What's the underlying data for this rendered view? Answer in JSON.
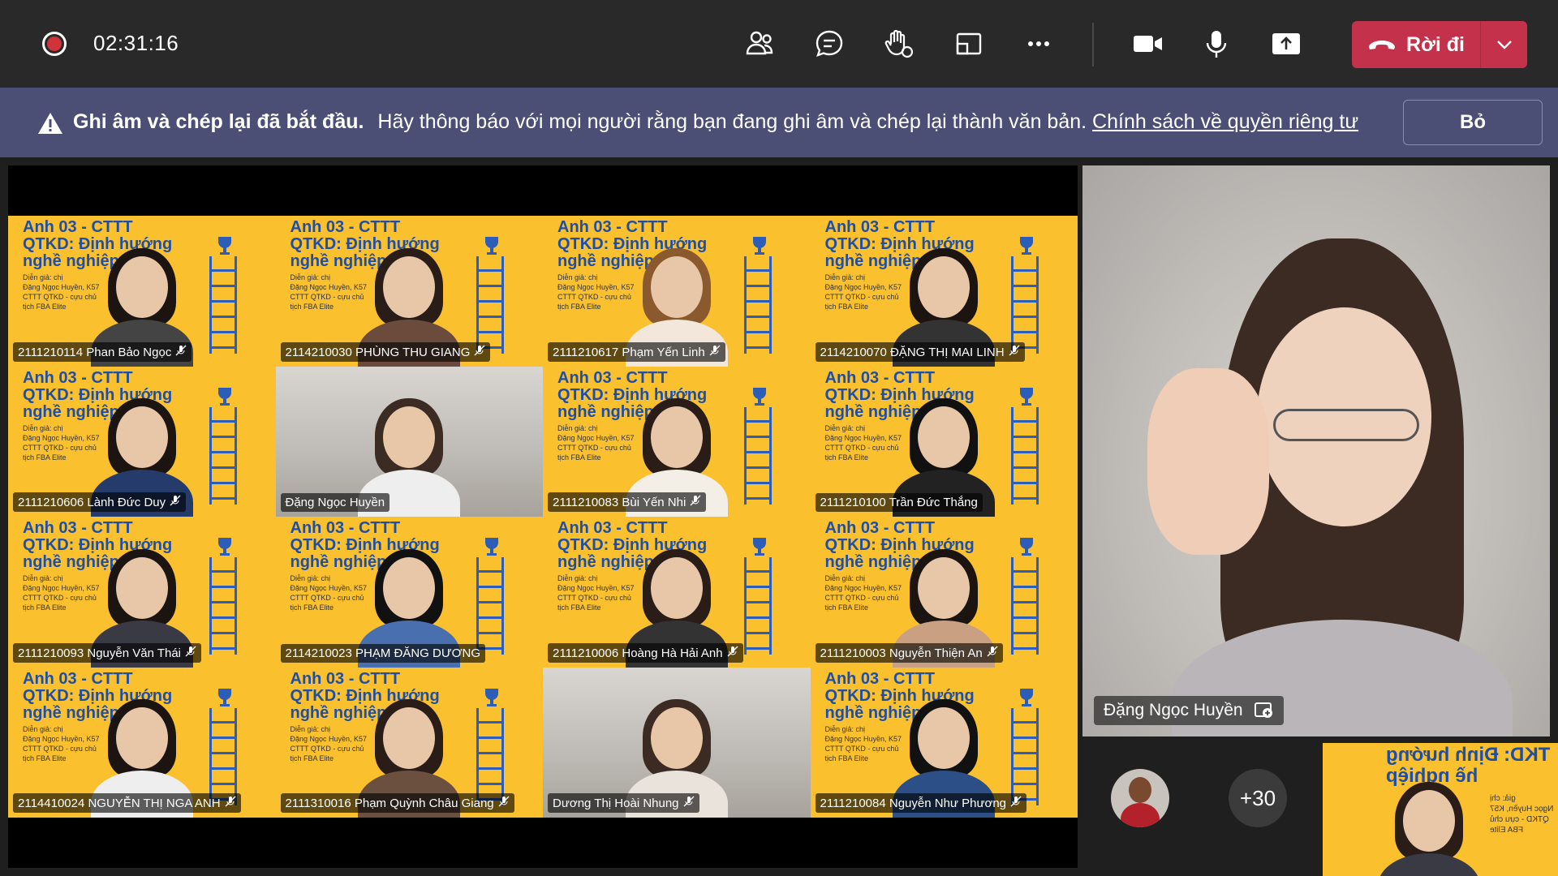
{
  "top_bar": {
    "timer": "02:31:16",
    "icons": [
      "people-icon",
      "chat-icon",
      "raise-hand-icon",
      "share-tray-icon",
      "more-icon"
    ],
    "leave_label": "Rời đi"
  },
  "banner": {
    "bold": "Ghi âm và chép lại đã bắt đầu.",
    "message": "Hãy thông báo với mọi người rằng bạn đang ghi âm và chép lại thành văn bản.",
    "link": "Chính sách về quyền riêng tư",
    "dismiss": "Bỏ"
  },
  "slide": {
    "title_lines": [
      "Anh 03 - CTTT",
      "QTKD: Định hướng",
      "nghề nghiệp"
    ],
    "sub_lines": [
      "Diễn giả: chị",
      "Đặng Ngọc Huyền, K57",
      "CTTT QTKD - cựu chủ",
      "tịch FBA Elite"
    ]
  },
  "participants": [
    {
      "name": "2111210114 Phan Bảo Ngọc",
      "bg": "slide",
      "muted": true
    },
    {
      "name": "2114210030 PHÙNG THU GIANG",
      "bg": "slide",
      "muted": true
    },
    {
      "name": "2111210617 Phạm Yến Linh",
      "bg": "slide",
      "muted": true
    },
    {
      "name": "2114210070 ĐẶNG THỊ MAI LINH",
      "bg": "slide",
      "muted": true
    },
    {
      "name": "2111210606 Lành Đức Duy",
      "bg": "slide",
      "muted": true
    },
    {
      "name": "Đặng Ngọc Huyền",
      "bg": "room",
      "muted": false
    },
    {
      "name": "2111210083 Bùi Yến Nhi",
      "bg": "slide",
      "muted": true
    },
    {
      "name": "2111210100 Trần Đức Thắng",
      "bg": "slide",
      "muted": false
    },
    {
      "name": "2111210093 Nguyễn Văn Thái",
      "bg": "slide",
      "muted": true
    },
    {
      "name": "2114210023 PHẠM ĐĂNG DƯƠNG",
      "bg": "slide",
      "muted": false
    },
    {
      "name": "2111210006 Hoàng Hà Hải Anh",
      "bg": "slide",
      "muted": true
    },
    {
      "name": "2111210003 Nguyễn Thiện An",
      "bg": "slide",
      "muted": true
    },
    {
      "name": "2114410024 NGUYỄN THỊ NGA ANH",
      "bg": "slide",
      "muted": true
    },
    {
      "name": "2111310016 Phạm Quỳnh Châu Giang",
      "bg": "slide",
      "muted": true
    },
    {
      "name": "Dương Thị Hoài Nhung",
      "bg": "room",
      "muted": true
    },
    {
      "name": "2111210084 Nguyễn Như Phương",
      "bg": "slide",
      "muted": true
    }
  ],
  "spotlight": {
    "name": "Đặng Ngọc Huyền"
  },
  "overflow": {
    "count": "+30"
  },
  "self_view": {
    "title_lines": [
      "TKD: Định hướng",
      "hề nghiệp"
    ],
    "sub_lines": [
      "giả: chị",
      "Ngọc Huyền, K57",
      "QTKD - cựu chủ",
      "FBA Elite"
    ]
  },
  "colors": {
    "leave": "#c4314b",
    "banner": "#4b4e75",
    "slide_yellow": "#fbc02d",
    "slide_blue": "#1e4fa8"
  }
}
